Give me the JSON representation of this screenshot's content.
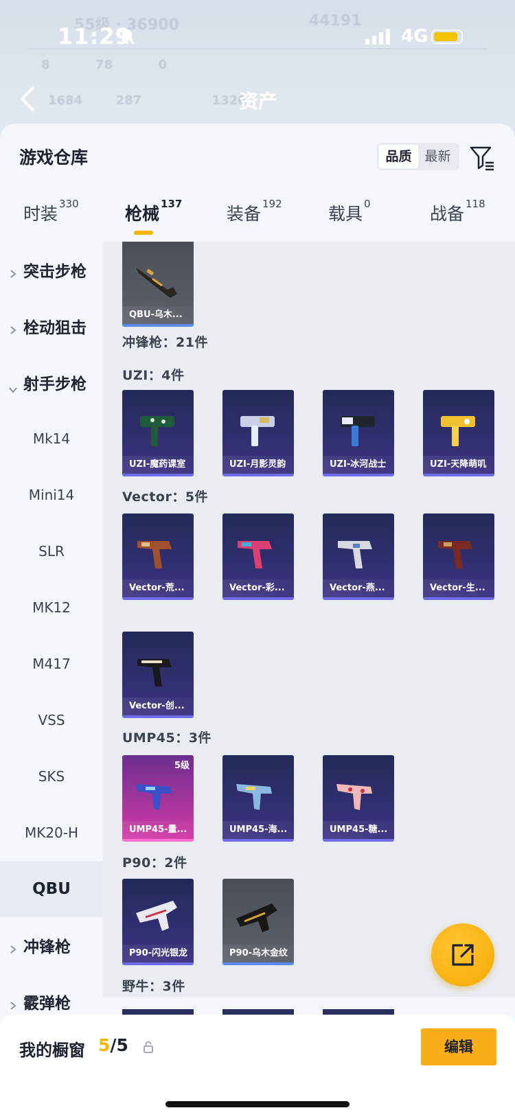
{
  "status_bar": {
    "time": "11:29",
    "network": "4G"
  },
  "header": {
    "title": "资产"
  },
  "sheet": {
    "title": "游戏仓库",
    "sort_options": [
      "品质",
      "最新"
    ],
    "active_sort": "品质"
  },
  "tabs": [
    {
      "label": "时装",
      "count": "330"
    },
    {
      "label": "枪械",
      "count": "137"
    },
    {
      "label": "装备",
      "count": "192"
    },
    {
      "label": "载具",
      "count": "0"
    },
    {
      "label": "战备",
      "count": "118"
    }
  ],
  "active_tab": "枪械",
  "sidebar": {
    "items": [
      {
        "label": "突击步枪",
        "type": "group",
        "expanded": false
      },
      {
        "label": "栓动狙击",
        "type": "group",
        "expanded": false
      },
      {
        "label": "射手步枪",
        "type": "group",
        "expanded": true
      },
      {
        "label": "Mk14",
        "type": "sub"
      },
      {
        "label": "Mini14",
        "type": "sub"
      },
      {
        "label": "SLR",
        "type": "sub"
      },
      {
        "label": "MK12",
        "type": "sub"
      },
      {
        "label": "M417",
        "type": "sub"
      },
      {
        "label": "VSS",
        "type": "sub"
      },
      {
        "label": "SKS",
        "type": "sub"
      },
      {
        "label": "MK20-H",
        "type": "sub"
      },
      {
        "label": "QBU",
        "type": "sub",
        "selected": true
      },
      {
        "label": "冲锋枪",
        "type": "group",
        "expanded": false
      },
      {
        "label": "霰弹枪",
        "type": "group",
        "expanded": false
      }
    ]
  },
  "content": {
    "top_item": {
      "name": "QBU-乌木...",
      "tier": "grey"
    },
    "category_label": "冲锋枪：21件",
    "groups": [
      {
        "label": "UZI：4件",
        "items": [
          {
            "name": "UZI-魔药课室",
            "tier": "purple"
          },
          {
            "name": "UZI-月影灵韵",
            "tier": "purple"
          },
          {
            "name": "UZI-冰河战士",
            "tier": "purple"
          },
          {
            "name": "UZI-天降萌叽",
            "tier": "purple"
          }
        ]
      },
      {
        "label": "Vector：5件",
        "items": [
          {
            "name": "Vector-荒...",
            "tier": "purple"
          },
          {
            "name": "Vector-彩...",
            "tier": "purple"
          },
          {
            "name": "Vector-燕...",
            "tier": "purple"
          },
          {
            "name": "Vector-生...",
            "tier": "purple"
          },
          {
            "name": "Vector-创...",
            "tier": "purple"
          }
        ]
      },
      {
        "label": "UMP45：3件",
        "items": [
          {
            "name": "UMP45-量...",
            "tier": "pink",
            "level": "5级"
          },
          {
            "name": "UMP45-海...",
            "tier": "purple"
          },
          {
            "name": "UMP45-糖...",
            "tier": "purple"
          }
        ]
      },
      {
        "label": "P90：2件",
        "items": [
          {
            "name": "P90-闪光银龙",
            "tier": "purple"
          },
          {
            "name": "P90-乌木金纹",
            "tier": "grey"
          }
        ]
      },
      {
        "label": "野牛：3件",
        "items": []
      }
    ]
  },
  "showcase": {
    "title": "我的橱窗",
    "used": "5",
    "total": "5",
    "edit_label": "编辑"
  },
  "colors": {
    "accent": "#f7b500",
    "purple_card": "#3c3381",
    "pink_card": "#d23aa6",
    "grey_card": "#5c606a"
  },
  "icons": [
    "bell-muted-icon",
    "signal-icon",
    "battery-icon",
    "back-chevron-icon",
    "filter-icon",
    "chevron-right-icon",
    "chevron-down-icon",
    "share-icon",
    "lock-icon"
  ]
}
